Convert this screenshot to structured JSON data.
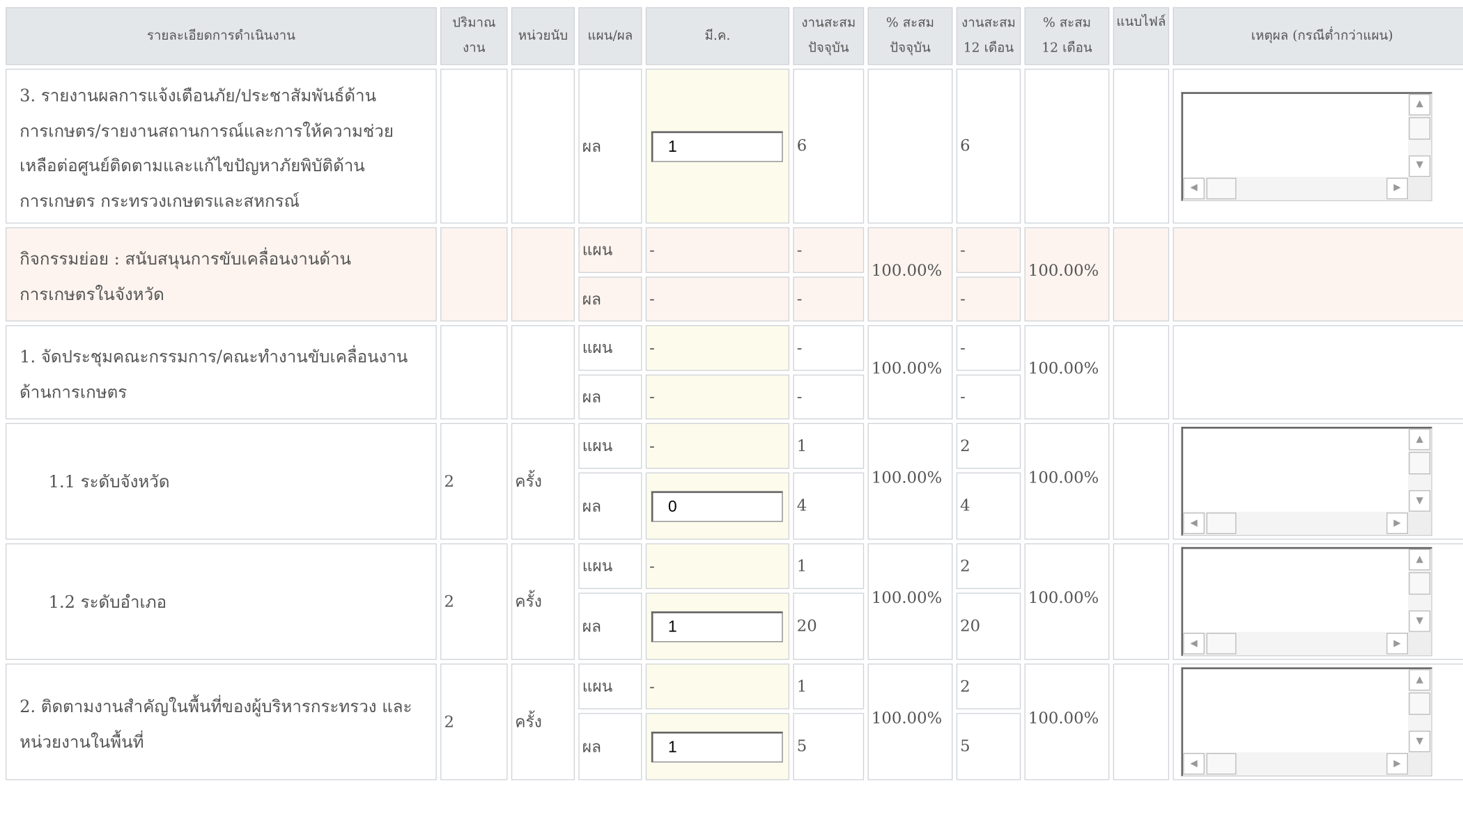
{
  "headers": {
    "detail": "รายละเอียดการดำเนินงาน",
    "quantity": "ปริมาณงาน",
    "unit": "หน่วยนับ",
    "plan_result": "แผน/ผล",
    "month": "มี.ค.",
    "cum_current_1": "งานสะสม",
    "cum_current_2": "ปัจจุบัน",
    "pct_current_1": "% สะสม",
    "pct_current_2": "ปัจจุบัน",
    "cum_12_1": "งานสะสม",
    "cum_12_2": "12 เดือน",
    "pct_12_1": "% สะสม",
    "pct_12_2": "12 เดือน",
    "attach": "แนบไฟล์",
    "reason": "เหตุผล (กรณีต่ำกว่าแผน)"
  },
  "row3": {
    "detail": "3. รายงานผลการแจ้งเตือนภัย/ประชาสัมพันธ์ด้านการเกษตร/รายงานสถานการณ์และการให้ความช่วยเหลือต่อศูนย์ติดตามและแก้ไขปัญหาภัยพิบัติด้านการเกษตร กระทรวงเกษตรและสหกรณ์",
    "label": "ผล",
    "month_value": "1",
    "cum_current": "6",
    "cum_12": "6"
  },
  "activity": {
    "detail": "กิจกรรมย่อย : สนับสนุนการขับเคลื่อนงานด้านการเกษตรในจังหวัด",
    "plan_label": "แผน",
    "result_label": "ผล",
    "plan_month": "-",
    "result_month": "-",
    "plan_cum": "-",
    "result_cum": "-",
    "pct_current": "100.00%",
    "plan_cum12": "-",
    "result_cum12": "-",
    "pct_12": "100.00%"
  },
  "item1": {
    "detail": "1. จัดประชุมคณะกรรมการ/คณะทำงานขับเคลื่อนงานด้านการเกษตร",
    "plan_label": "แผน",
    "result_label": "ผล",
    "plan_month": "-",
    "result_month": "-",
    "plan_cum": "-",
    "result_cum": "-",
    "pct_current": "100.00%",
    "plan_cum12": "-",
    "result_cum12": "-",
    "pct_12": "100.00%"
  },
  "item11": {
    "detail": "1.1 ระดับจังหวัด",
    "quantity": "2",
    "unit": "ครั้ง",
    "plan_label": "แผน",
    "result_label": "ผล",
    "plan_month": "-",
    "result_month_value": "0",
    "plan_cum": "1",
    "result_cum": "4",
    "pct_current": "100.00%",
    "plan_cum12": "2",
    "result_cum12": "4",
    "pct_12": "100.00%"
  },
  "item12": {
    "detail": "1.2 ระดับอำเภอ",
    "quantity": "2",
    "unit": "ครั้ง",
    "plan_label": "แผน",
    "result_label": "ผล",
    "plan_month": "-",
    "result_month_value": "1",
    "plan_cum": "1",
    "result_cum": "20",
    "pct_current": "100.00%",
    "plan_cum12": "2",
    "result_cum12": "20",
    "pct_12": "100.00%"
  },
  "item2": {
    "detail": "2. ติดตามงานสำคัญในพื้นที่ของผู้บริหารกระทรวง และหน่วยงานในพื้นที่",
    "quantity": "2",
    "unit": "ครั้ง",
    "plan_label": "แผน",
    "result_label": "ผล",
    "plan_month": "-",
    "result_month_value": "1",
    "plan_cum": "1",
    "result_cum": "5",
    "pct_current": "100.00%",
    "plan_cum12": "2",
    "result_cum12": "5",
    "pct_12": "100.00%"
  },
  "colors": {
    "header_bg": "#e4e7ea",
    "month_bg": "#fdfcec",
    "activity_bg": "#fdf4ef",
    "border": "#cfd3d8"
  }
}
